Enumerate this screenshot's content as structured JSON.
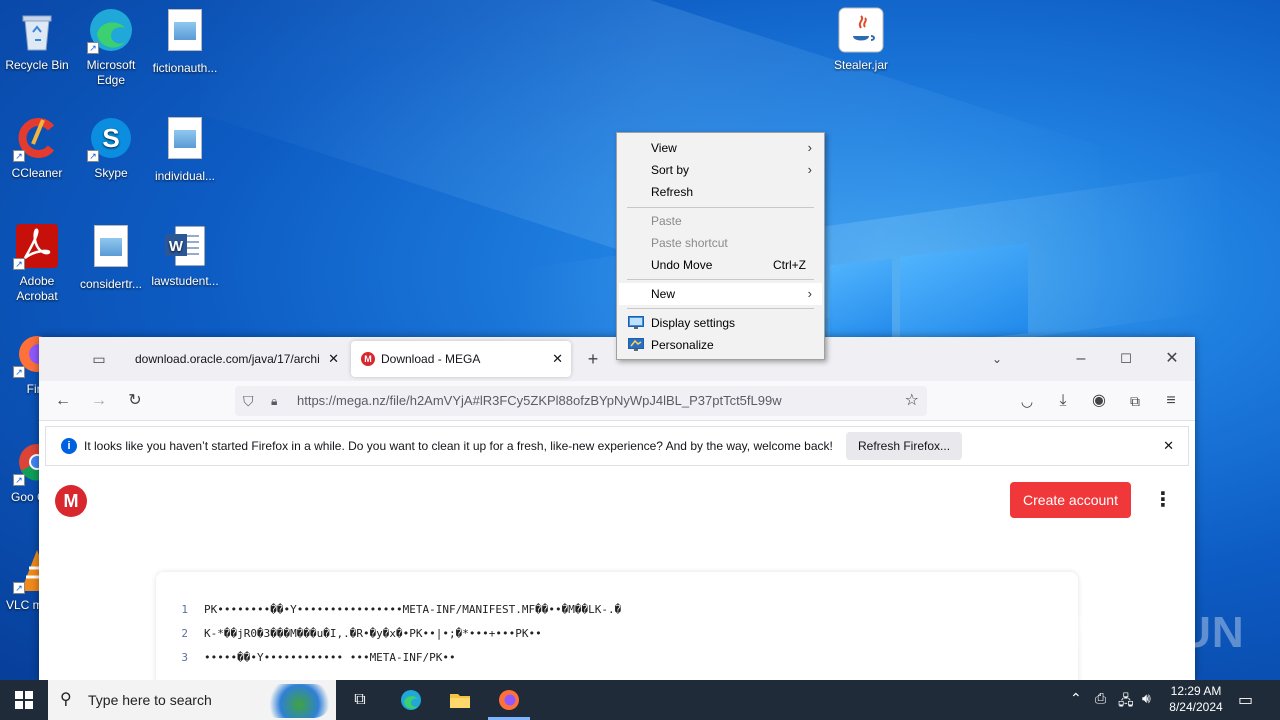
{
  "desktop": {
    "icons": [
      {
        "label": "Recycle Bin",
        "icon": "recycle-bin-icon"
      },
      {
        "label": "Microsoft Edge",
        "icon": "edge-icon"
      },
      {
        "label": "fictionauth...",
        "icon": "image-file-icon"
      },
      {
        "label": "Stealer.jar",
        "icon": "java-icon"
      },
      {
        "label": "CCleaner",
        "icon": "ccleaner-icon"
      },
      {
        "label": "Skype",
        "icon": "skype-icon"
      },
      {
        "label": "individual...",
        "icon": "image-file-icon"
      },
      {
        "label": "Adobe Acrobat",
        "icon": "acrobat-icon"
      },
      {
        "label": "considertr...",
        "icon": "image-file-icon"
      },
      {
        "label": "lawstudent...",
        "icon": "word-icon"
      },
      {
        "label": "Fire",
        "icon": "firefox-icon"
      },
      {
        "label": "Goo Chro",
        "icon": "chrome-icon"
      },
      {
        "label": "VLC m play",
        "icon": "vlc-icon"
      }
    ]
  },
  "context_menu": {
    "items": [
      {
        "label": "View",
        "submenu": true
      },
      {
        "label": "Sort by",
        "submenu": true
      },
      {
        "label": "Refresh"
      },
      {
        "label": "Paste",
        "disabled": true
      },
      {
        "label": "Paste shortcut",
        "disabled": true
      },
      {
        "label": "Undo Move",
        "accel": "Ctrl+Z"
      },
      {
        "label": "New",
        "submenu": true,
        "highlighted": true
      },
      {
        "label": "Display settings",
        "icon": "display-settings-icon"
      },
      {
        "label": "Personalize",
        "icon": "personalize-icon"
      }
    ]
  },
  "browser": {
    "tabs": [
      {
        "label": "download.oracle.com/java/17/archi",
        "active": false
      },
      {
        "label": "Download - MEGA",
        "active": true
      }
    ],
    "url": "https://mega.nz/file/h2AmVYjA#lR3FCy5ZKPl88ofzBYpNyWpJ4lBL_P37ptTct5fL99w",
    "notification": {
      "text": "It looks like you haven’t started Firefox in a while. Do you want to clean it up for a fresh, like-new experience? And by the way, welcome back!",
      "button": "Refresh Firefox..."
    },
    "page": {
      "logo": "M",
      "create_account": "Create account",
      "code_lines": [
        {
          "n": "1",
          "text": "PK••••••••��•Y••••••••••••••••META-INF/MANIFEST.MF��••�M��LK-.�"
        },
        {
          "n": "2",
          "text": "K-*��jR0�3���M���u�I,.�R•�y�x�•PK••|•;�*•••+•••PK••"
        },
        {
          "n": "3",
          "text": "•••••��•Y••••••••••••   •••META-INF/PK••"
        }
      ]
    }
  },
  "watermark": "ANY RUN",
  "taskbar": {
    "search_placeholder": "Type here to search",
    "time": "12:29 AM",
    "date": "8/24/2024"
  }
}
